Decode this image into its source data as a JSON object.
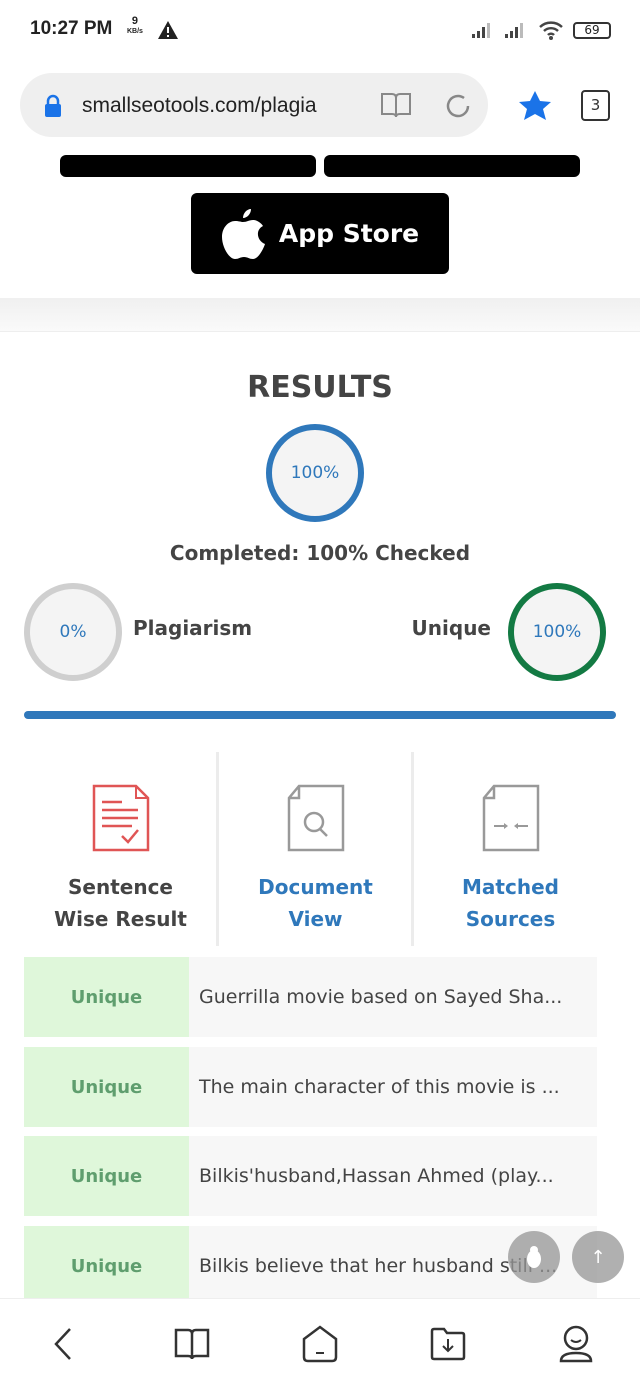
{
  "status_bar": {
    "time": "10:27 PM",
    "speed_value": "9",
    "speed_unit": "KB/s",
    "battery": "69"
  },
  "browser": {
    "url": "smallseotools.com/plagia",
    "tab_count": "3",
    "accent": "#1a73e8"
  },
  "app_store": {
    "label": "App Store"
  },
  "results": {
    "title": "RESULTS",
    "progress": "100%",
    "completed": "Completed: 100% Checked",
    "plagiarism": {
      "value": "0%",
      "label": "Plagiarism"
    },
    "unique": {
      "value": "100%",
      "label": "Unique"
    },
    "progress_fraction": 1.0
  },
  "tabs": [
    {
      "line1": "Sentence",
      "line2": "Wise Result",
      "icon": "sentence-check-icon"
    },
    {
      "line1": "Document",
      "line2": "View",
      "icon": "document-search-icon"
    },
    {
      "line1": "Matched",
      "line2": "Sources",
      "icon": "document-compare-icon"
    }
  ],
  "rows": [
    {
      "status": "Unique",
      "text": "Guerrilla movie based on Sayed Sha..."
    },
    {
      "status": "Unique",
      "text": "The main character of this movie is ..."
    },
    {
      "status": "Unique",
      "text": "Bilkis'husband,Hassan Ahmed (play..."
    },
    {
      "status": "Unique",
      "text": "Bilkis believe that her husband still ..."
    }
  ],
  "fab": {
    "up": "↑"
  },
  "colors": {
    "blue": "#2f78bb",
    "green": "#137a43",
    "unique_bg": "#dff7da",
    "red": "#e05555"
  }
}
